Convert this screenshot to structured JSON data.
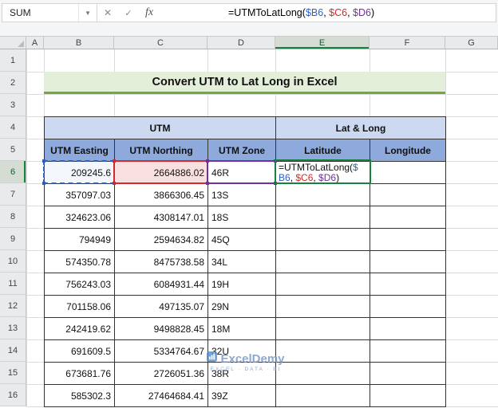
{
  "chrome": {
    "name_box": "SUM",
    "cancel": "✕",
    "enter": "✓",
    "fx": "fx",
    "formula": {
      "prefix": "=UTMToLatLong(",
      "ref1": "$B6",
      "sep1": ", ",
      "ref2": "$C6",
      "sep2": ", ",
      "ref3": "$D6",
      "close": ")"
    }
  },
  "grid": {
    "columns": [
      "A",
      "B",
      "C",
      "D",
      "E",
      "F",
      "G"
    ],
    "rows": [
      "1",
      "2",
      "3",
      "4",
      "5",
      "6",
      "7",
      "8",
      "9",
      "10",
      "11",
      "12",
      "13",
      "14",
      "15",
      "16"
    ],
    "active_column": "E",
    "active_row": "6"
  },
  "sheet": {
    "title": "Convert UTM to Lat Long in Excel",
    "table": {
      "group1": "UTM",
      "group2": "Lat & Long",
      "headers": [
        "UTM Easting",
        "UTM Northing",
        "UTM Zone",
        "Latitude",
        "Longitude"
      ],
      "active_row": {
        "easting": "209245.6",
        "northing": "2664886.02",
        "zone": "46R",
        "formula": {
          "line1_text": "=UTMToLatLong(",
          "line1_ref": "$",
          "line2_ref1": "B6",
          "line2_sep1": ", ",
          "line2_ref2": "$C6",
          "line2_sep2": ", ",
          "line2_ref3": "$D6",
          "line2_close": ")"
        }
      },
      "rows": [
        {
          "easting": "357097.03",
          "northing": "3866306.45",
          "zone": "13S"
        },
        {
          "easting": "324623.06",
          "northing": "4308147.01",
          "zone": "18S"
        },
        {
          "easting": "794949",
          "northing": "2594634.82",
          "zone": "45Q"
        },
        {
          "easting": "574350.78",
          "northing": "8475738.58",
          "zone": "34L"
        },
        {
          "easting": "756243.03",
          "northing": "6084931.44",
          "zone": "19H"
        },
        {
          "easting": "701158.06",
          "northing": "497135.07",
          "zone": "29N"
        },
        {
          "easting": "242419.62",
          "northing": "9498828.45",
          "zone": "18M"
        },
        {
          "easting": "691609.5",
          "northing": "5334764.67",
          "zone": "32U"
        },
        {
          "easting": "673681.76",
          "northing": "2726051.36",
          "zone": "38R"
        },
        {
          "easting": "585302.3",
          "northing": "27464684.41",
          "zone": "39Z"
        }
      ]
    }
  },
  "watermark": {
    "brand": "ExcelDemy",
    "tagline": "EXCEL · DATA · BI"
  },
  "colors": {
    "header_fill": "#8EA9DB",
    "group_fill": "#CDD9F0",
    "title_fill": "#E3EFD9",
    "title_underline": "#6FA93F",
    "ref_blue": "#2C5FC4",
    "ref_red": "#D02A2A",
    "ref_purple": "#7030A0",
    "active_cell_green": "#17823F",
    "watermark_blue": "#7A99C5"
  }
}
